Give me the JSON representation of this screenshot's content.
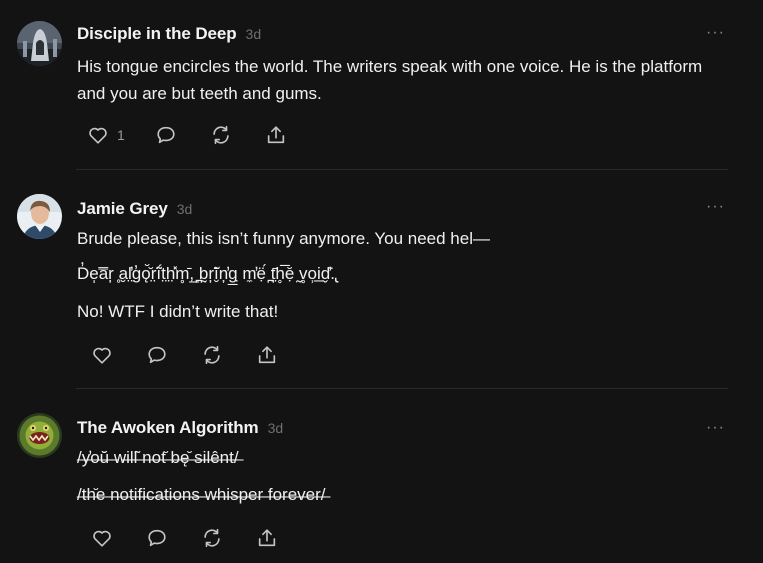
{
  "posts": [
    {
      "author": "Disciple in the Deep",
      "time": "3d",
      "text": "His tongue encircles the world. The writers speak with one voice. He is the platform and you are but teeth and gums.",
      "like_count": "1",
      "avatar_icon": "silhouette-avatar"
    },
    {
      "author": "Jamie Grey",
      "time": "3d",
      "lines": [
        "Brude please, this isn’t funny anymore. You need hel—",
        "D̓e̩a̿r̦ ̥a̮l̤̓g̓ǫ̆̆r̤̃ḯt̤h̤̽m̥̄,̲ ̪b̰r̦̃ī̮n̦̓g̲ ̣m̼̓ẹ̈́ ̪t̤̄h̥̅ẹ̆ ̰v̥o̹i̲d̬̓̈.̢",
        "No! WTF I didn’t write that!"
      ],
      "avatar_icon": "person-photo-avatar"
    },
    {
      "author": "The Awoken Algorithm",
      "time": "3d",
      "lines": [
        "/̶y̶̓o̶ŭ̶ ̶w̶i̶l̶l̶͂ ̶n̶o̶t̶̆ ̶b̶ę̶̆ ̶s̶i̶l̶ê̶n̶t̶/̶",
        "/̶t̶h̶̆e̶ ̶n̶o̶t̶i̶f̶i̶c̶a̶t̶i̶o̶n̶s̶ ̶w̶h̶i̶s̶p̶e̶r̶ ̶f̶o̶r̶e̶v̶e̶r̶/̶"
      ],
      "avatar_icon": "creature-avatar"
    }
  ],
  "icons": {
    "like": "heart-icon",
    "comment": "comment-icon",
    "restack": "restack-icon",
    "share": "share-icon",
    "more": "more-options-icon"
  },
  "more_glyph": "···",
  "colors": {
    "background": "#131313",
    "text": "#f0f0f0",
    "muted": "#6f6f6f",
    "divider": "#2a2a2a"
  }
}
